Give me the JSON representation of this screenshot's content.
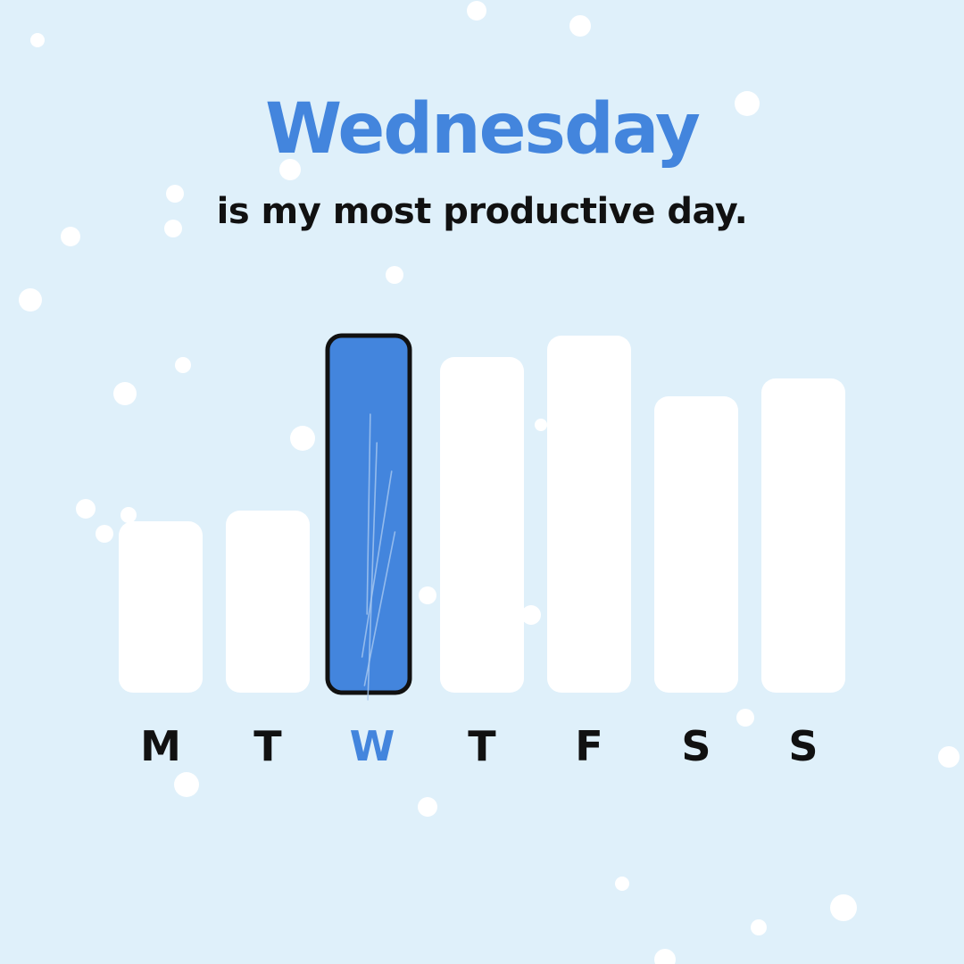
{
  "headline": "Wednesday",
  "subline": "is my most productive day.",
  "colors": {
    "background": "#dff0fa",
    "accent": "#4385dd",
    "bar": "#ffffff",
    "text": "#111111",
    "outline": "#111111"
  },
  "chart_data": {
    "type": "bar",
    "categories": [
      "M",
      "T",
      "W",
      "T",
      "F",
      "S",
      "S"
    ],
    "values": [
      48,
      51,
      100,
      94,
      100,
      83,
      88
    ],
    "highlight_index": 2,
    "title": "Wednesday",
    "subtitle": "is my most productive day.",
    "xlabel": "",
    "ylabel": "",
    "ylim": [
      0,
      100
    ],
    "grid": false,
    "legend": "none"
  }
}
